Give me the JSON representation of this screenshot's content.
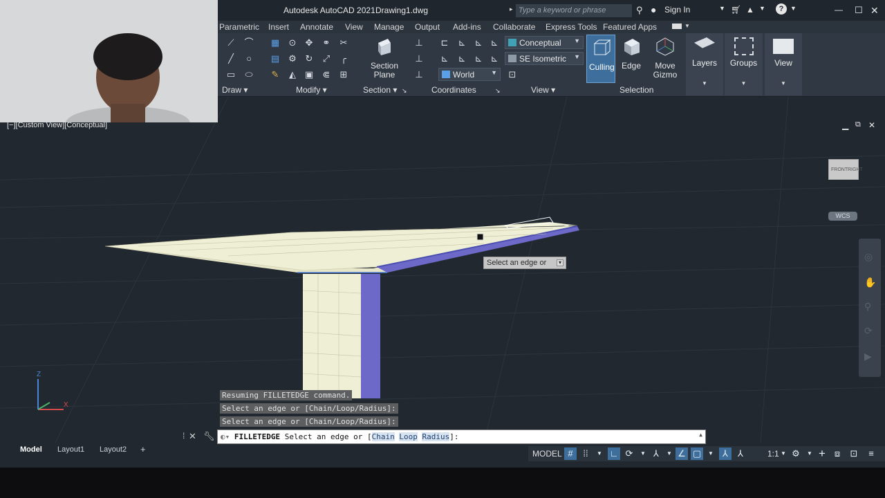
{
  "app": {
    "title": "Autodesk AutoCAD 2021",
    "file": "Drawing1.dwg",
    "search_placeholder": "Type a keyword or phrase",
    "sign_in": "Sign In"
  },
  "tabs": [
    "Parametric",
    "Insert",
    "Annotate",
    "View",
    "Manage",
    "Output",
    "Add-ins",
    "Collaborate",
    "Express Tools",
    "Featured Apps"
  ],
  "ribbon": {
    "panels": {
      "draw": "Draw",
      "modify": "Modify",
      "section": "Section",
      "coordinates": "Coordinates",
      "view": "View",
      "selection": "Selection"
    },
    "section_plane": {
      "line1": "Section",
      "line2": "Plane"
    },
    "visual_style": "Conceptual",
    "view_preset": "SE Isometric",
    "ucs": "World",
    "culling": "Culling",
    "edge": "Edge",
    "move_gizmo": {
      "line1": "Move",
      "line2": "Gizmo"
    },
    "layers": "Layers",
    "groups": "Groups",
    "view_btn": "View"
  },
  "viewport": {
    "label": "[−][Custom View][Conceptual]",
    "tooltip": "Select an edge or",
    "viewcube_front": "FRONT",
    "viewcube_right": "RIGHT",
    "wcs": "WCS",
    "axis_z": "Z",
    "axis_x": "X"
  },
  "command": {
    "history": [
      "Resuming FILLETEDGE command.",
      "Select an edge or [Chain/Loop/Radius]:",
      "Select an edge or [Chain/Loop/Radius]:"
    ],
    "current_cmd": "FILLETEDGE",
    "prompt": "Select an edge or [",
    "options": [
      "Chain",
      "Loop",
      "Radius"
    ],
    "prompt_end": "]:"
  },
  "layout_tabs": [
    "Model",
    "Layout1",
    "Layout2"
  ],
  "status": {
    "model": "MODEL",
    "scale": "1:1"
  },
  "colors": {
    "background": "#212830",
    "solid_face": "#efefd6",
    "selected_face": "#6d69c9",
    "accent": "#3e6f9c"
  }
}
